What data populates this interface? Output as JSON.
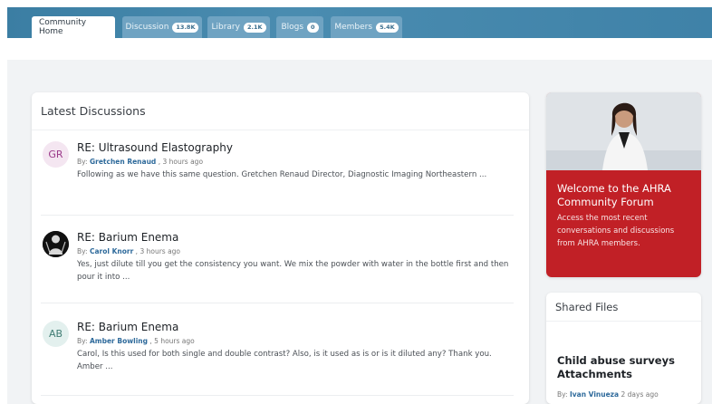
{
  "tabs": [
    {
      "label": "Community Home",
      "badge": ""
    },
    {
      "label": "Discussion",
      "badge": "13.8K"
    },
    {
      "label": "Library",
      "badge": "2.1K"
    },
    {
      "label": "Blogs",
      "badge": "0"
    },
    {
      "label": "Members",
      "badge": "5.4K"
    }
  ],
  "latest": {
    "title": "Latest Discussions",
    "posts": [
      {
        "initials": "GR",
        "title": "RE: Ultrasound Elastography",
        "by": "By:",
        "author": "Gretchen Renaud",
        "time": ", 3 hours ago",
        "excerpt": "Following as we have this same question. Gretchen Renaud Director, Diagnostic Imaging Northeastern ..."
      },
      {
        "initials": "",
        "title": "RE: Barium Enema",
        "by": "By:",
        "author": "Carol Knorr",
        "time": ", 3 hours ago",
        "excerpt": "Yes, just dilute till you get the consistency you want. We mix the powder with water in the bottle first and then pour it into ..."
      },
      {
        "initials": "AB",
        "title": "RE: Barium Enema",
        "by": "By:",
        "author": "Amber Bowling",
        "time": ", 5 hours ago",
        "excerpt": "Carol, Is this used for both single and double contrast? Also, is it used as is or is it diluted any? Thank you. Amber ..."
      }
    ]
  },
  "hero": {
    "title": "Welcome to the AHRA Community Forum",
    "text": "Access the most recent conversations and discussions from AHRA members."
  },
  "shared_files": {
    "title": "Shared Files",
    "file_title": "Child abuse surveys Attachments",
    "by": "By:",
    "author": "Ivan Vinueza",
    "time": "2 days ago"
  },
  "colors": {
    "tabbar": "#3b7ea3",
    "hero": "#c12026",
    "author_link": "#2e6a9b"
  }
}
